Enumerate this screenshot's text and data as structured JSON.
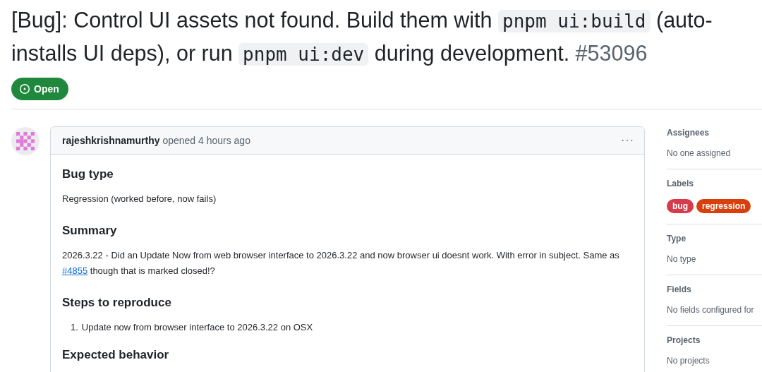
{
  "title": {
    "lines": [
      [
        {
          "kind": "text",
          "text": "[Bug]: Control UI assets not found. Build them with "
        },
        {
          "kind": "code",
          "text": "pnpm ui:build"
        },
        {
          "kind": "text",
          "text": " (auto-"
        }
      ],
      [
        {
          "kind": "text",
          "text": "installs UI deps), or run "
        },
        {
          "kind": "code",
          "text": "pnpm ui:dev"
        },
        {
          "kind": "text",
          "text": " during development. "
        },
        {
          "kind": "number",
          "text": "#53096"
        }
      ]
    ]
  },
  "state": {
    "label": "Open",
    "open": true
  },
  "comment": {
    "author": "rajeshkrishnamurthy",
    "action": "opened 4 hours ago",
    "menu": "···",
    "sections": [
      {
        "heading": "Bug type",
        "kind": "paragraph",
        "parts": [
          {
            "kind": "text",
            "text": "Regression (worked before, now fails)"
          }
        ]
      },
      {
        "heading": "Summary",
        "kind": "paragraph",
        "parts": [
          {
            "kind": "text",
            "text": "2026.3.22 - Did an Update Now from web browser interface to 2026.3.22 and now browser ui doesnt work. With error in subject. Same as "
          },
          {
            "kind": "link",
            "text": "#4855"
          },
          {
            "kind": "text",
            "text": " though that is marked closed!?"
          }
        ]
      },
      {
        "heading": "Steps to reproduce",
        "kind": "list",
        "items": [
          {
            "marker": "1.",
            "text": "Update now from browser interface to 2026.3.22 on OSX"
          }
        ]
      },
      {
        "heading": "Expected behavior",
        "kind": "none"
      }
    ]
  },
  "sidebar": [
    {
      "title": "Assignees",
      "kind": "text",
      "value": "No one assigned"
    },
    {
      "title": "Labels",
      "kind": "labels",
      "labels": [
        {
          "text": "bug",
          "color": "#d73a4a"
        },
        {
          "text": "regression",
          "color": "#d93f0b"
        }
      ]
    },
    {
      "title": "Type",
      "kind": "text",
      "value": "No type"
    },
    {
      "title": "Fields",
      "kind": "text",
      "value": "No fields configured for"
    },
    {
      "title": "Projects",
      "kind": "text",
      "value": "No projects"
    }
  ]
}
